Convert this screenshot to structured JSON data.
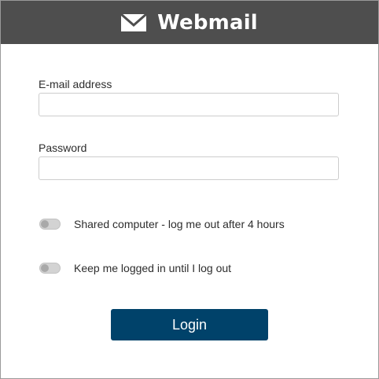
{
  "header": {
    "icon": "envelope-icon",
    "title": "Webmail",
    "background_color": "#4e4e4e"
  },
  "form": {
    "email": {
      "label": "E-mail address",
      "value": "",
      "placeholder": ""
    },
    "password": {
      "label": "Password",
      "value": "",
      "placeholder": ""
    },
    "options": {
      "shared_computer": {
        "label": "Shared computer - log me out after 4 hours",
        "checked": false
      },
      "keep_logged_in": {
        "label": "Keep me logged in until I log out",
        "checked": false
      }
    },
    "login_label": "Login",
    "login_color": "#00426a"
  }
}
